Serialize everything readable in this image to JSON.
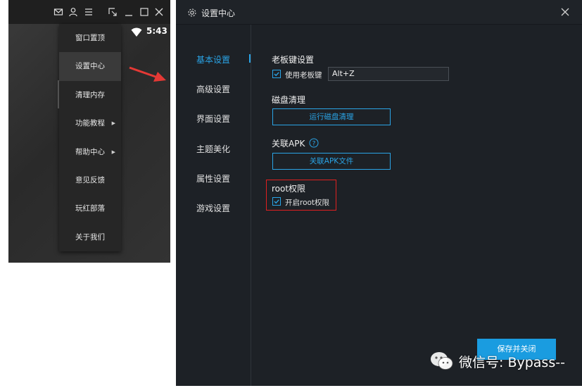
{
  "emulator": {
    "time": "5:43",
    "menu": {
      "items": [
        {
          "label": "窗口置顶"
        },
        {
          "label": "设置中心"
        },
        {
          "label": "清理内存"
        },
        {
          "label": "功能教程",
          "submenu": true
        },
        {
          "label": "帮助中心",
          "submenu": true
        },
        {
          "label": "意见反馈"
        },
        {
          "label": "玩红部落"
        },
        {
          "label": "关于我们"
        }
      ],
      "active_index": 1
    }
  },
  "dialog": {
    "title": "设置中心",
    "nav": [
      {
        "label": "基本设置"
      },
      {
        "label": "高级设置"
      },
      {
        "label": "界面设置"
      },
      {
        "label": "主题美化"
      },
      {
        "label": "属性设置"
      },
      {
        "label": "游戏设置"
      }
    ],
    "active_nav": 0,
    "boss_key": {
      "title": "老板键设置",
      "checkbox_label": "使用老板键",
      "checked": true,
      "hotkey": "Alt+Z"
    },
    "disk_clean": {
      "title": "磁盘清理",
      "button": "运行磁盘清理"
    },
    "apk": {
      "title": "关联APK",
      "button": "关联APK文件"
    },
    "root": {
      "title": "root权限",
      "checkbox_label": "开启root权限",
      "checked": true
    },
    "save_button": "保存并关闭"
  },
  "watermark": {
    "text": "微信号: Bypass--"
  },
  "colors": {
    "accent": "#2aa4e6",
    "highlight": "#e02020",
    "dialog_bg": "#1d2126"
  }
}
